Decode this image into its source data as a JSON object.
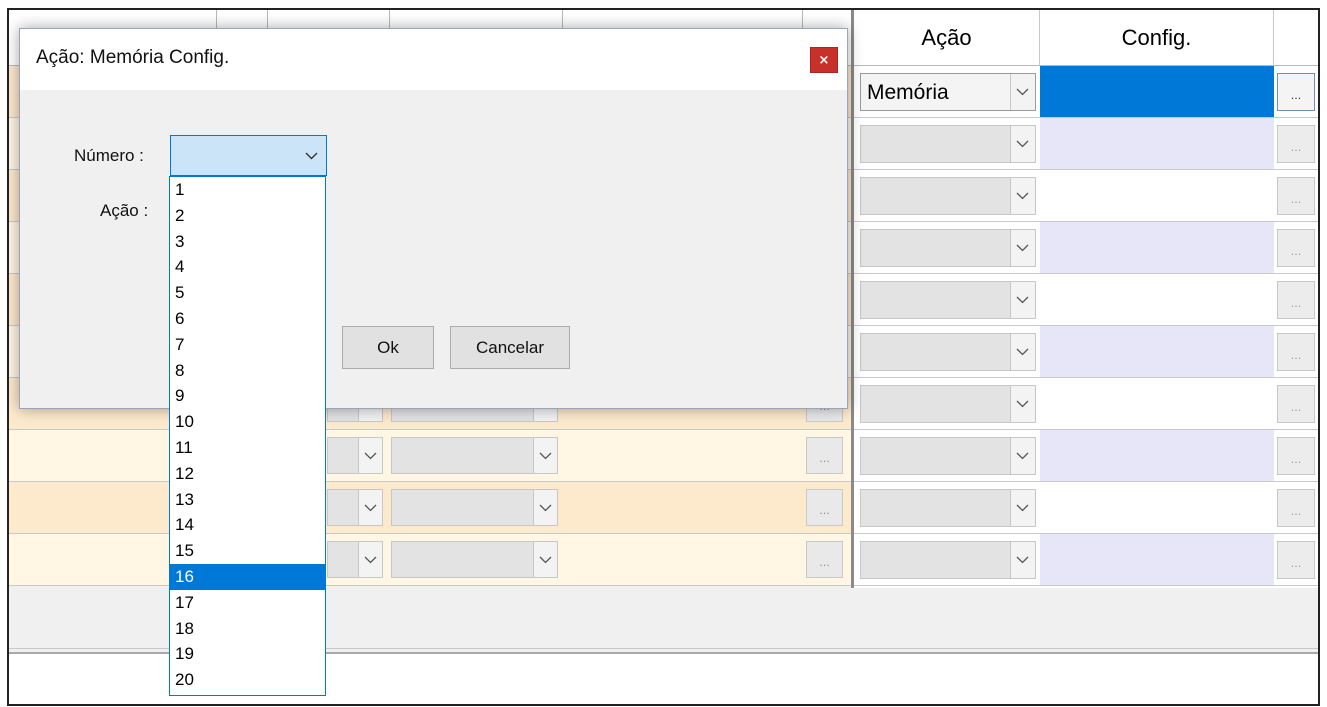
{
  "dialog": {
    "title": "Ação: Memória Config.",
    "close_label": "×",
    "numero_label": "Número :",
    "acao_label": "Ação :",
    "numero_value": "",
    "ok_label": "Ok",
    "cancel_label": "Cancelar"
  },
  "numero_options": [
    "1",
    "2",
    "3",
    "4",
    "5",
    "6",
    "7",
    "8",
    "9",
    "10",
    "11",
    "12",
    "13",
    "14",
    "15",
    "16",
    "17",
    "18",
    "19",
    "20"
  ],
  "numero_selected_index": 15,
  "grid": {
    "headers": {
      "acao": "Ação",
      "config": "Config."
    },
    "rows": [
      {
        "acao": "Memória",
        "config": "",
        "dots": "...",
        "selected": true
      },
      {
        "acao": "",
        "config": "",
        "dots": "..."
      },
      {
        "acao": "",
        "config": "",
        "dots": "..."
      },
      {
        "acao": "",
        "config": "",
        "dots": "..."
      },
      {
        "acao": "",
        "config": "",
        "dots": "..."
      },
      {
        "acao": "",
        "config": "",
        "dots": "..."
      },
      {
        "acao": "",
        "config": "",
        "dots": "..."
      },
      {
        "acao": "",
        "config": "",
        "dots": "..."
      },
      {
        "acao": "",
        "config": "",
        "dots": "..."
      },
      {
        "acao": "",
        "config": "",
        "dots": "..."
      }
    ]
  },
  "colors": {
    "selection": "#0078d7",
    "row_even": "#fde9cc",
    "row_odd": "#fff6e4",
    "config_alt": "#e6e6f8",
    "close_button": "#c8312a"
  }
}
